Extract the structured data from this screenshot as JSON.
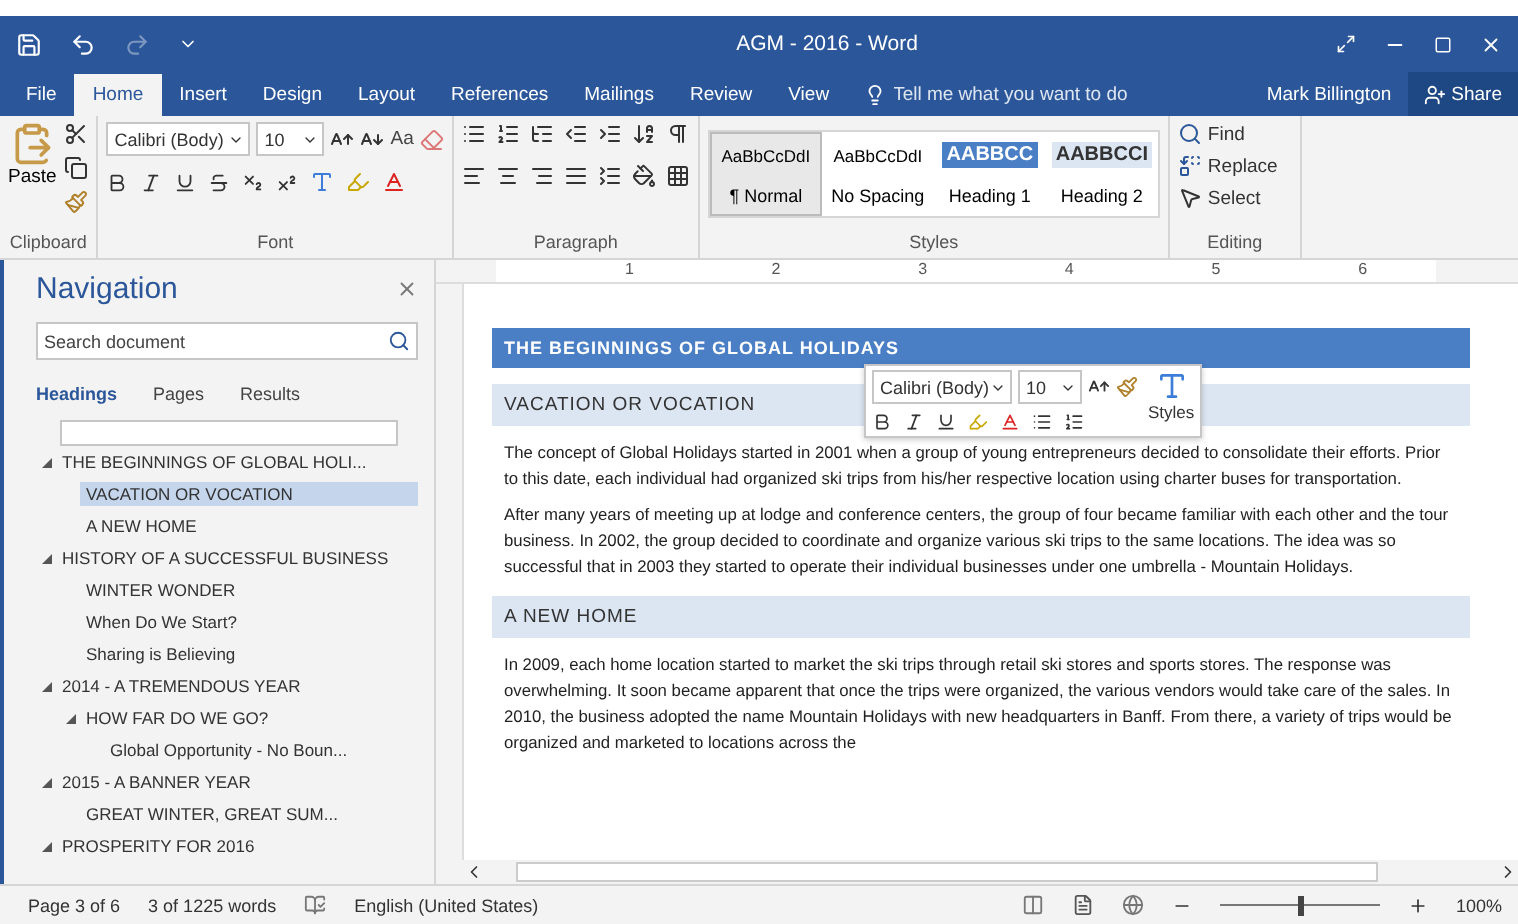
{
  "window": {
    "title": "AGM - 2016 - Word"
  },
  "tabs": [
    {
      "label": "File",
      "selected": false
    },
    {
      "label": "Home",
      "selected": true
    },
    {
      "label": "Insert",
      "selected": false
    },
    {
      "label": "Design",
      "selected": false
    },
    {
      "label": "Layout",
      "selected": false
    },
    {
      "label": "References",
      "selected": false
    },
    {
      "label": "Mailings",
      "selected": false
    },
    {
      "label": "Review",
      "selected": false
    },
    {
      "label": "View",
      "selected": false
    }
  ],
  "tell_me": {
    "placeholder": "Tell me what you want to do"
  },
  "user": "Mark Billington",
  "share_button": "Share",
  "ribbon": {
    "clipboard": {
      "paste": "Paste",
      "label": "Clipboard"
    },
    "font": {
      "font_name": "Calibri (Body)",
      "font_size": "10",
      "case_button": "Aa",
      "label": "Font"
    },
    "paragraph": {
      "label": "Paragraph"
    },
    "styles": {
      "label": "Styles",
      "gallery": [
        {
          "sample": "AaBbCcDdI",
          "name": "¶ Normal",
          "kind": "normal",
          "selected": true
        },
        {
          "sample": "AaBbCcDdI",
          "name": "No Spacing",
          "kind": "normal",
          "selected": false
        },
        {
          "sample": "AABBCC",
          "name": "Heading 1",
          "kind": "heading1",
          "selected": false
        },
        {
          "sample": "AABBCCI",
          "name": "Heading 2",
          "kind": "heading2",
          "selected": false
        }
      ]
    },
    "editing": {
      "label": "Editing",
      "items": [
        {
          "label": "Find",
          "kind": "find"
        },
        {
          "label": "Replace",
          "kind": "replace"
        },
        {
          "label": "Select",
          "kind": "select"
        }
      ]
    }
  },
  "navigation": {
    "title": "Navigation",
    "search": {
      "placeholder": "Search document"
    },
    "tabs": [
      {
        "label": "Headings",
        "selected": true
      },
      {
        "label": "Pages",
        "selected": false
      },
      {
        "label": "Results",
        "selected": false
      }
    ],
    "headings": [
      {
        "label": "THE BEGINNINGS OF GLOBAL HOLI...",
        "expanded": true,
        "selected": false,
        "children": [
          {
            "label": "VACATION OR VOCATION",
            "selected": true
          },
          {
            "label": "A NEW HOME",
            "selected": false
          }
        ]
      },
      {
        "label": "HISTORY OF A SUCCESSFUL BUSINESS",
        "expanded": true,
        "selected": false,
        "children": [
          {
            "label": "WINTER WONDER",
            "selected": false
          },
          {
            "label": "When Do We Start?",
            "selected": false
          },
          {
            "label": "Sharing is Believing",
            "selected": false
          }
        ]
      },
      {
        "label": "2014 - A TREMENDOUS YEAR",
        "expanded": true,
        "selected": false,
        "children": [
          {
            "label": "HOW FAR DO WE GO?",
            "expanded": true,
            "selected": false,
            "children": [
              {
                "label": "Global Opportunity - No Boun...",
                "selected": false
              }
            ]
          }
        ]
      },
      {
        "label": "2015 - A BANNER YEAR",
        "expanded": true,
        "selected": false,
        "children": [
          {
            "label": "GREAT WINTER, GREAT SUM...",
            "selected": false
          }
        ]
      },
      {
        "label": "PROSPERITY FOR 2016",
        "expanded": true,
        "selected": false
      }
    ]
  },
  "ruler": [
    "1",
    "2",
    "3",
    "4",
    "5",
    "6"
  ],
  "document": {
    "title": "THE BEGINNINGS OF GLOBAL HOLIDAYS",
    "sections": [
      {
        "heading": "VACATION OR VOCATION",
        "paragraphs": [
          "The concept of Global Holidays started in 2001 when a group of young entrepreneurs decided to consolidate their efforts.  Prior to this date, each individual had organized ski trips from his/her respective location using charter buses for transportation.",
          "After many years of meeting up at lodge and conference centers, the group of four became familiar with each other and the tour business.  In 2002, the group decided to coordinate and organize various ski trips to the same locations.  The idea was so successful that in 2003 they started to operate their individual businesses under one umbrella - Mountain Holidays."
        ]
      },
      {
        "heading": "A NEW HOME",
        "paragraphs": [
          "In 2009, each home location started to market the ski trips through retail ski stores and sports stores.  The response was overwhelming.  It soon became apparent that once the trips were organized, the various vendors would take care of the sales.  In 2010, the business adopted the name Mountain Holidays with new headquarters in Banff.  From there, a variety of trips would be organized and marketed to locations across the"
        ]
      }
    ]
  },
  "mini_toolbar": {
    "font_name": "Calibri (Body)",
    "font_size": "10",
    "styles": "Styles"
  },
  "status_bar": {
    "page": "Page 3 of 6",
    "words": "3 of 1225 words",
    "language": "English (United States)",
    "zoom": "100%",
    "zoom_slider": {
      "level": 0.5
    }
  }
}
